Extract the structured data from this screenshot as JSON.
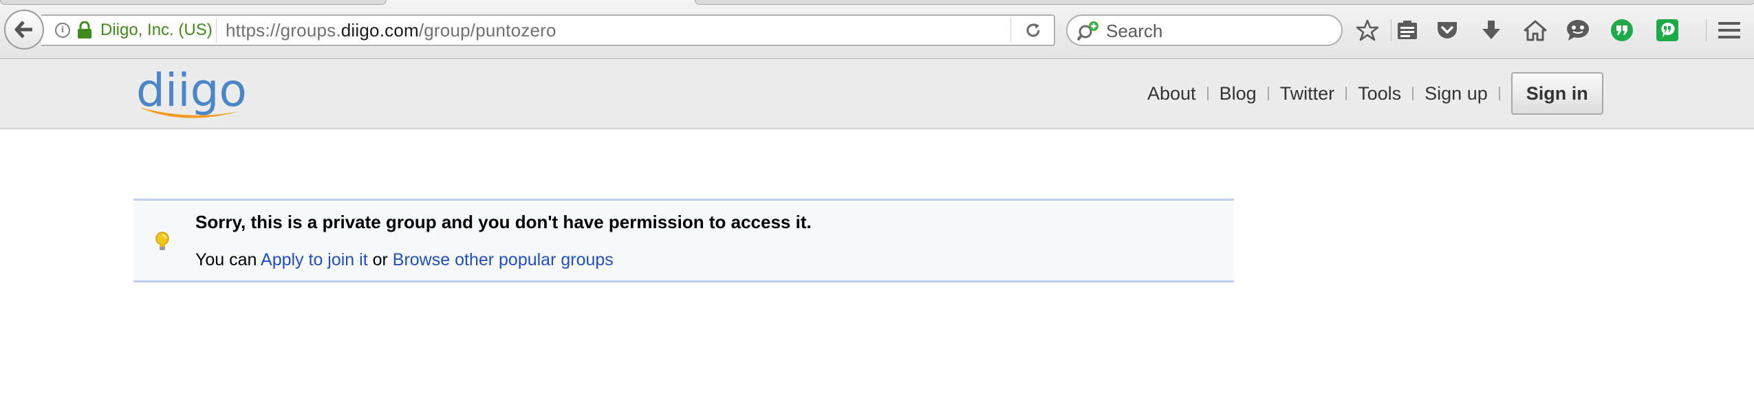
{
  "browser": {
    "identity_label": "Diigo, Inc. (US)",
    "url_prefix": "https://groups.",
    "url_domain": "diigo.com",
    "url_path": "/group/puntozero",
    "search_placeholder": "Search",
    "icons": [
      "back-arrow-icon",
      "info-icon",
      "lock-icon",
      "reload-icon",
      "search-engine-icon",
      "bookmark-star-icon",
      "reading-list-icon",
      "pocket-icon",
      "download-icon",
      "home-icon",
      "chat-bubble-icon",
      "hangouts-icon",
      "hangouts-square-icon",
      "hamburger-menu-icon"
    ]
  },
  "site": {
    "logo_text": "diigo",
    "nav": {
      "about": "About",
      "blog": "Blog",
      "twitter": "Twitter",
      "tools": "Tools",
      "signup": "Sign up",
      "signin": "Sign in"
    }
  },
  "notice": {
    "title": "Sorry, this is a private group and you don't have permission to access it.",
    "prefix": "You can ",
    "apply_link": "Apply to join it",
    "or": " or ",
    "browse_link": "Browse other popular groups"
  },
  "colors": {
    "logo_blue": "#4a86c8",
    "logo_orange": "#f29b1d",
    "secure_green": "#3f8a1a",
    "link_blue": "#1f4fbf",
    "notice_border": "#bdd0f0",
    "hangouts_green": "#1faa4a"
  }
}
